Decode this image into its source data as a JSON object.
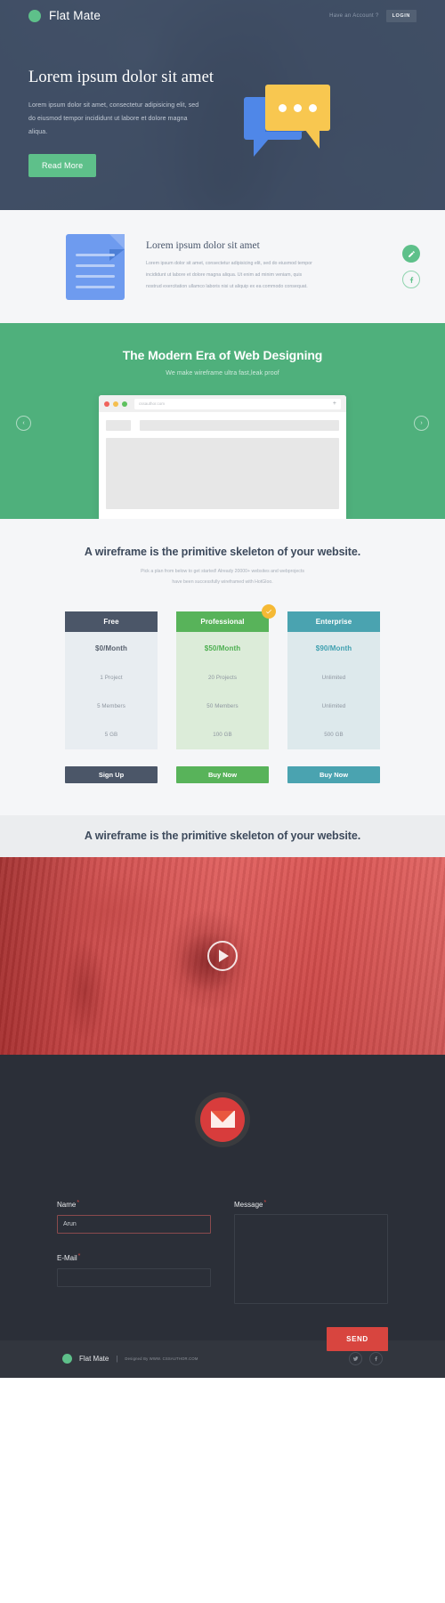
{
  "header": {
    "brand": "Flat Mate",
    "have_account": "Have an Account ?",
    "login_label": "LOGIN"
  },
  "hero": {
    "title": "Lorem ipsum dolor sit amet",
    "subtitle": "Lorem ipsum dolor sit amet, consectetur adipisicing elit, sed do eiusmod tempor incididunt ut labore et dolore magna aliqua.",
    "cta_label": "Read More"
  },
  "feature": {
    "title": "Lorem ipsum dolor sit amet",
    "paragraph": "Lorem ipsum dolor sit amet, consectetur adipisicing elit, sed do eiusmod tempor incididunt ut labore et dolore magna aliqua. Ut enim ad minim veniam, quis nostrud exercitation ullamco laboris nisi ut aliquip ex ea commodo consequat.",
    "edit_icon": "pencil-icon",
    "facebook_icon": "facebook-icon"
  },
  "slider": {
    "title": "The Modern Era of Web Designing",
    "subtitle": "We make wireframe ultra fast,leak proof",
    "browser_url": "cssauthor.com",
    "prev_label": "‹",
    "next_label": "›",
    "plus_label": "+"
  },
  "pricing": {
    "title": "A wireframe is the primitive skeleton of your website.",
    "subtitle_line1": "Pick a plan from below to get started! Already 20000+ websites and webprojects",
    "subtitle_line2": "have been successfully wireframed with HotGloo.",
    "badge_icon": "check-icon",
    "plans": [
      {
        "name": "Free",
        "price": "$0/Month",
        "projects": "1 Project",
        "members": "5 Members",
        "storage": "5 GB",
        "button": "Sign Up",
        "color": "#4b5668",
        "featured": false
      },
      {
        "name": "Professional",
        "price": "$50/Month",
        "projects": "20 Projects",
        "members": "50 Members",
        "storage": "100 GB",
        "button": "Buy Now",
        "color": "#58b35a",
        "featured": true
      },
      {
        "name": "Enterprise",
        "price": "$90/Month",
        "projects": "Unlimited",
        "members": "Unlimited",
        "storage": "500 GB",
        "button": "Buy Now",
        "color": "#4aa3b0",
        "featured": false
      }
    ]
  },
  "video": {
    "title": "A wireframe is the primitive skeleton of your website.",
    "play_icon": "play-icon"
  },
  "contact": {
    "mail_icon": "envelope-icon",
    "name_label": "Name",
    "name_required": "*",
    "name_value": "Arun",
    "name_placeholder": "",
    "email_label": "E-Mail",
    "email_required": "*",
    "email_value": "",
    "email_placeholder": "",
    "message_label": "Message",
    "message_required": "*",
    "message_value": "",
    "message_placeholder": "",
    "send_label": "SEND"
  },
  "footer": {
    "brand": "Flat Mate",
    "separator": "|",
    "credit": "Designed By WWW. CSSAUTHOR.COM",
    "twitter_icon": "twitter-icon",
    "facebook_icon": "facebook-icon"
  }
}
